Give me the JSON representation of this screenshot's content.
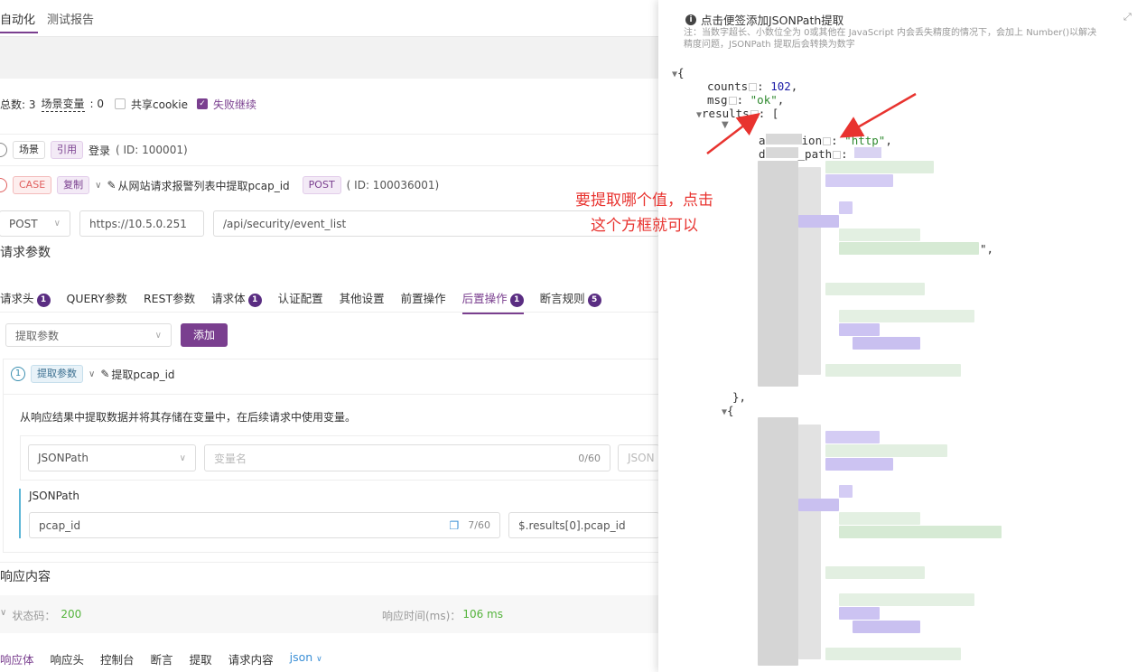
{
  "top_tabs": {
    "auto": "自动化",
    "report": "测试报告"
  },
  "scenario_bar": {
    "total_label": "总数: 3",
    "vars_label": "场景变量",
    "vars_value": ": 0",
    "share_cookie": "共享cookie",
    "continue_on_fail": "失败继续"
  },
  "step1": {
    "tag_scene": "场景",
    "tag_ref": "引用",
    "name": "登录",
    "id": "( ID: 100001)"
  },
  "step2": {
    "tag_case": "CASE",
    "tag_copy": "复制",
    "name": "从网站请求报警列表中提取pcap_id",
    "method_tag": "POST",
    "id": "( ID: 100036001)"
  },
  "request": {
    "method": "POST",
    "host": "https://10.5.0.251",
    "path": "/api/security/event_list"
  },
  "params_title": "请求参数",
  "sub_tabs": [
    {
      "label": "请求头",
      "badge": "1"
    },
    {
      "label": "QUERY参数",
      "badge": ""
    },
    {
      "label": "REST参数",
      "badge": ""
    },
    {
      "label": "请求体",
      "badge": "1"
    },
    {
      "label": "认证配置",
      "badge": ""
    },
    {
      "label": "其他设置",
      "badge": ""
    },
    {
      "label": "前置操作",
      "badge": ""
    },
    {
      "label": "后置操作",
      "badge": "1"
    },
    {
      "label": "断言规则",
      "badge": "5"
    }
  ],
  "post_ops": {
    "select_placeholder": "提取参数",
    "add_button": "添加"
  },
  "extract": {
    "index": "1",
    "tag": "提取参数",
    "name": "提取pcap_id",
    "desc": "从响应结果中提取数据并将其存储在变量中，在后续请求中使用变量。",
    "type": "JSONPath",
    "var_placeholder": "变量名",
    "var_count": "0/60",
    "right_cut": "JSON",
    "jsonpath_label": "JSONPath",
    "var_value": "pcap_id",
    "value_count": "7/60",
    "path_value": "$.results[0].pcap_id"
  },
  "response": {
    "title": "响应内容",
    "status_label": "状态码：",
    "status_value": "200",
    "time_label": "响应时间(ms)：",
    "time_value": "106 ms"
  },
  "bottom_tabs": [
    "响应体",
    "响应头",
    "控制台",
    "断言",
    "提取",
    "请求内容"
  ],
  "format": "json",
  "panel": {
    "title": "点击便签添加JSONPath提取",
    "note_line1": "注：当数字超长、小数位全为 0或其他在 JavaScript 内会丢失精度的情况下，会加上 Number()以解决",
    "note_line2": "精度问题，JSONPath 提取后会转换为数字"
  },
  "json_tree": {
    "open": "{",
    "counts_key": "counts",
    "counts_val": "102",
    "msg_key": "msg",
    "msg_val": "\"ok\"",
    "results_key": "results",
    "bracket": "[",
    "field1_key_a": "a",
    "field1_key_b": "ion",
    "field1_val": "\"http\"",
    "field2_key_a": "d",
    "field2_key_b": "_path",
    "quote_end": "\",",
    "close_obj": "},",
    "open2": "{"
  },
  "annotation": {
    "line1": "要提取哪个值，点击",
    "line2": "这个方框就可以"
  },
  "colors": {
    "accent": "#7a3f8f",
    "badge": "#5a2d82",
    "annotation": "#e8332f",
    "json_number": "#1a1aa6",
    "json_string": "#2f8a2f"
  }
}
